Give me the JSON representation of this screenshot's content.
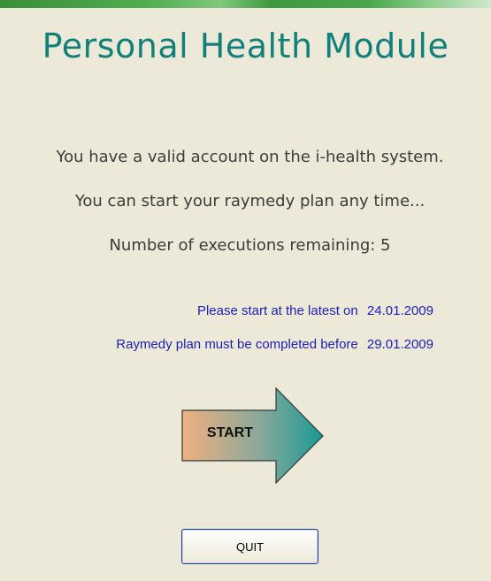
{
  "header": {
    "title": "Personal Health Module"
  },
  "messages": {
    "valid_account": "You have a valid account on the i-health system.",
    "start_any_time": "You can start your raymedy plan any time...",
    "executions_remaining": "Number of executions remaining: 5"
  },
  "dates": {
    "start_label": "Please start at the latest on",
    "start_date": "24.01.2009",
    "complete_label": "Raymedy plan must be completed before",
    "complete_date": "29.01.2009"
  },
  "actions": {
    "start_label": "START",
    "quit_label": "QUIT"
  },
  "colors": {
    "title": "#12807a",
    "date_text": "#2020b0",
    "arrow_gradient_start": "#f0b080",
    "arrow_gradient_end": "#1a9a95",
    "background": "#ece9d8"
  },
  "icons": {
    "start": "right-arrow-icon"
  }
}
